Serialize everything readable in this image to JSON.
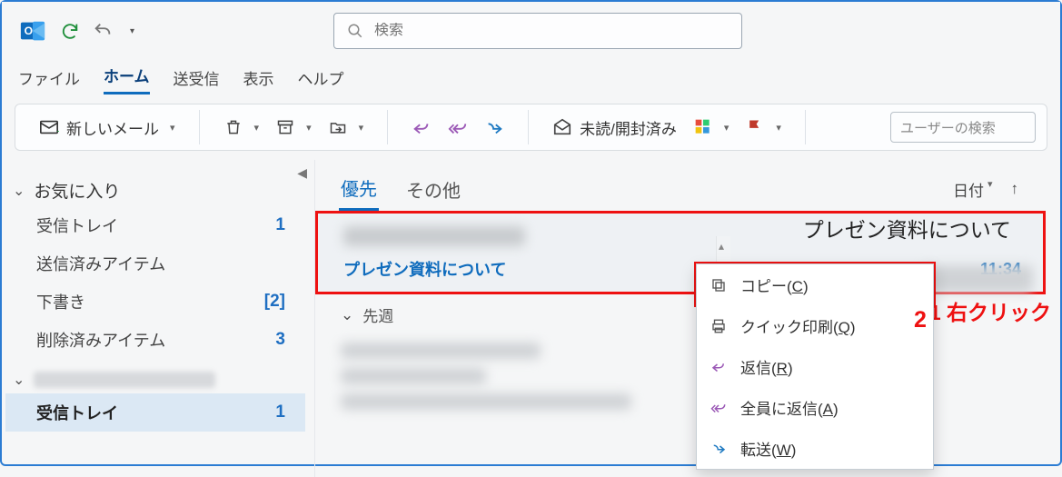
{
  "titlebar": {},
  "search": {
    "placeholder": "検索"
  },
  "tabs": {
    "file": "ファイル",
    "home": "ホーム",
    "sendrecv": "送受信",
    "view": "表示",
    "help": "ヘルプ"
  },
  "toolbar": {
    "new_mail": "新しいメール",
    "read_unread": "未読/開封済み",
    "people_search_placeholder": "ユーザーの検索"
  },
  "sidebar": {
    "favorites": "お気に入り",
    "items": [
      {
        "label": "受信トレイ",
        "count": "1"
      },
      {
        "label": "送信済みアイテム",
        "count": ""
      },
      {
        "label": "下書き",
        "count": "[2]"
      },
      {
        "label": "削除済みアイテム",
        "count": "3"
      }
    ],
    "account_items": [
      {
        "label": "受信トレイ",
        "count": "1"
      }
    ]
  },
  "list": {
    "tab_focused": "優先",
    "tab_other": "その他",
    "sort_label": "日付",
    "message1": {
      "subject": "プレゼン資料について",
      "time": "11:34"
    },
    "group_last_week": "先週",
    "annotation1": "1 右クリック"
  },
  "reading": {
    "title": "プレゼン資料について"
  },
  "context_menu": {
    "copy_pre": "コピー(",
    "copy_u": "C",
    "copy_post": ")",
    "quickprint_pre": "クイック印刷(",
    "quickprint_u": "Q",
    "quickprint_post": ")",
    "reply_pre": "返信(",
    "reply_u": "R",
    "reply_post": ")",
    "replyall_pre": "全員に返信(",
    "replyall_u": "A",
    "replyall_post": ")",
    "forward_pre": "転送(",
    "forward_u": "W",
    "forward_post": ")",
    "annotation2": "2"
  }
}
